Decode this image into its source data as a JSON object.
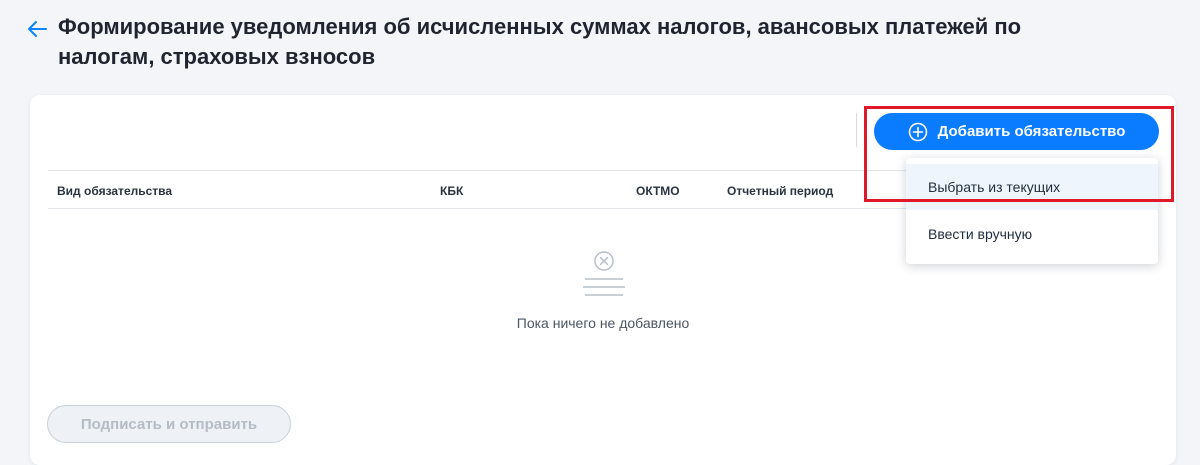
{
  "header": {
    "title": "Формирование уведомления об исчисленных суммах налогов, авансовых платежей по налогам, страховых взносов",
    "back_icon": "arrow-left-icon"
  },
  "toolbar": {
    "add_label": "Добавить обязательство",
    "add_icon": "plus-circle-icon",
    "accent_color": "#0a7cff"
  },
  "dropdown": {
    "items": [
      {
        "label": "Выбрать из текущих"
      },
      {
        "label": "Ввести вручную"
      }
    ]
  },
  "table": {
    "columns": [
      "Вид обязательства",
      "КБК",
      "ОКТМО",
      "Отчетный период"
    ]
  },
  "empty_state": {
    "text": "Пока ничего не добавлено",
    "icon": "empty-list-icon"
  },
  "footer": {
    "sign_label": "Подписать и отправить"
  },
  "highlight_color": "#e0192a"
}
